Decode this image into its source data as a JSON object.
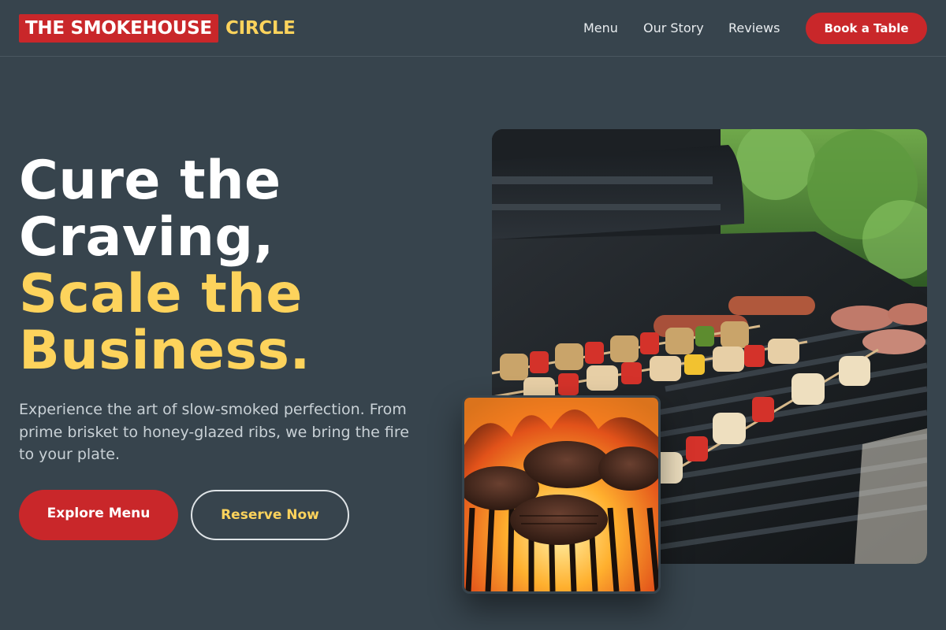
{
  "header": {
    "brand_primary": "THE SMOKEHOUSE",
    "brand_secondary": "CIRCLE",
    "nav": [
      "Menu",
      "Our Story",
      "Reviews"
    ],
    "cta_label": "Book a Table"
  },
  "hero": {
    "title_line1": "Cure the",
    "title_line2": "Craving,",
    "title_line3": "Scale the",
    "title_line4": "Business.",
    "description": "Experience the art of slow-smoked perfection. From prime brisket to honey-glazed ribs, we bring the fire to your plate.",
    "primary_button": "Explore Menu",
    "secondary_button": "Reserve Now"
  },
  "images": {
    "main_icon": "grill-skewers-photo",
    "small_icon": "burger-patties-flame-photo"
  },
  "colors": {
    "background": "#37444d",
    "accent_red": "#c9272a",
    "accent_yellow": "#fdd35c"
  }
}
